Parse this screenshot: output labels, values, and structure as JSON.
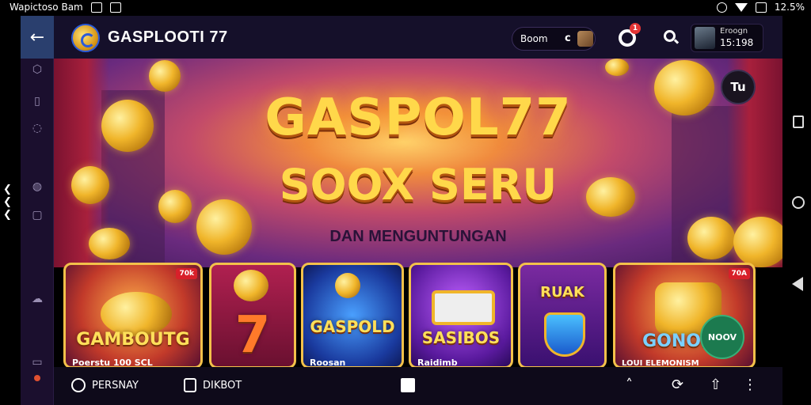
{
  "status_bar": {
    "left_text": "Wapictoso Bam",
    "right_text": "12.5%"
  },
  "header": {
    "brand": "GASPLOOTI 77",
    "pill_text": "Boom",
    "pill_letter": "c",
    "notification_count": "1",
    "user_line1": "Eroogn",
    "user_line2": "15:198"
  },
  "hero": {
    "title_line1": "GASPOL77",
    "title_line2": "SOOX SERU",
    "tagline": "DAN MENGUNTUNGAN",
    "language_button": "Tu"
  },
  "games": [
    {
      "title": "GAMBOUTG",
      "subtitle": "Poerstu 100 SCL",
      "badge": "70k"
    },
    {
      "title": "7",
      "subtitle": "",
      "badge": ""
    },
    {
      "title": "GASPOLD",
      "subtitle": "Roosan",
      "badge": ""
    },
    {
      "title": "SASIBOS",
      "subtitle": "Raidimb",
      "badge": ""
    },
    {
      "title": "RUAK",
      "subtitle": "",
      "badge": ""
    },
    {
      "title": "GONOLO",
      "subtitle": "LOUI ELEMONISM",
      "badge": "70A"
    }
  ],
  "play_button": "NOOV",
  "bottom_nav": {
    "item1": "PERSNAY",
    "item2": "DIKBOT"
  },
  "colors": {
    "accent_gold": "#ffd84a",
    "app_bg": "#15102a",
    "play_green": "#1c7a4f",
    "badge_red": "#d8202a"
  }
}
